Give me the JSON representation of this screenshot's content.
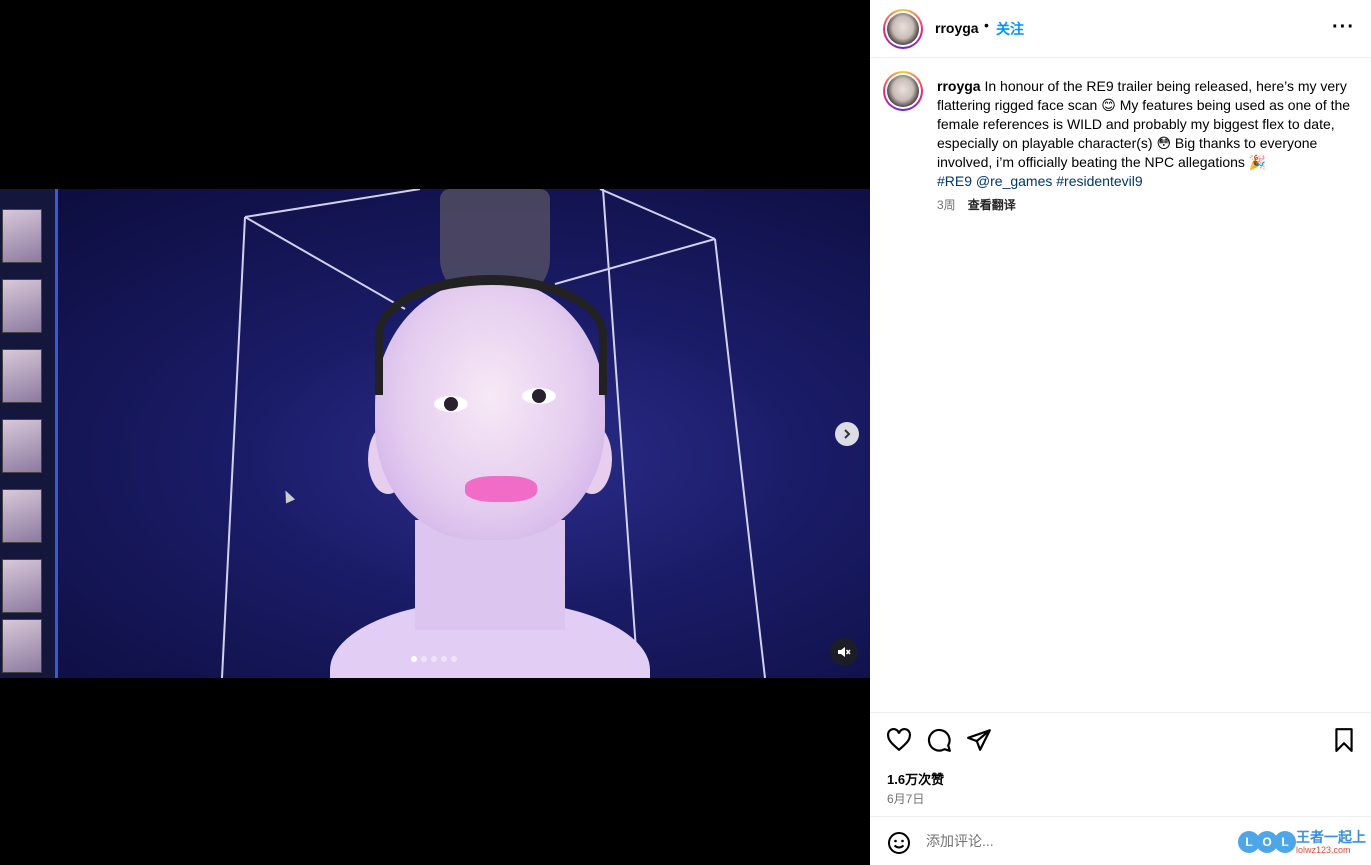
{
  "post": {
    "username": "rroyga",
    "separator": "•",
    "follow_label": "关注",
    "more_label": "···",
    "caption_text": "In honour of the RE9 trailer being released, here’s my very flattering rigged face scan 😊 My features being used as one of the female references is WILD and probably my biggest flex to date, especially on playable character(s) 😳 Big thanks to everyone involved, i’m officially beating the NPC allegations 🎉",
    "tags": "#RE9 @re_games #residentevil9",
    "age": "3周",
    "translate_label": "查看翻译",
    "likes": "1.6万次赞",
    "date": "6月7日",
    "comment_placeholder": "添加评论..."
  },
  "media": {
    "carousel_count": 5,
    "active_index": 0,
    "next_icon": "chevron-right-icon",
    "mute_icon": "speaker-muted-icon"
  },
  "icons": {
    "like": "heart-icon",
    "comment": "comment-bubble-icon",
    "share": "send-icon",
    "save": "bookmark-icon",
    "emoji": "emoji-icon"
  },
  "watermark": {
    "letters": [
      "L",
      "O",
      "L"
    ],
    "text": "王者一起上",
    "sub": "lolwz123.com"
  },
  "colors": {
    "link": "#0095f6",
    "tag": "#00376b",
    "muted": "#737373"
  }
}
